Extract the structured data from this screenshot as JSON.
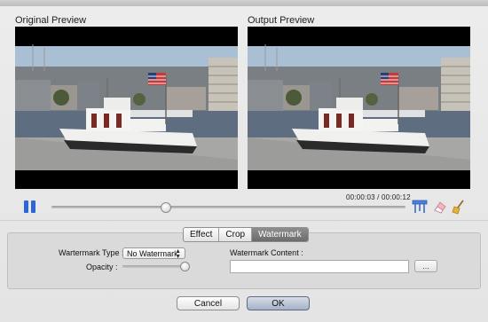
{
  "previews": {
    "original_title": "Original Preview",
    "output_title": "Output Preview"
  },
  "playback": {
    "state": "paused",
    "current_time": "00:00:03",
    "total_time": "00:00:12",
    "time_label": "00:00:03 / 00:00:12",
    "progress_fraction": 0.32
  },
  "tools": {
    "icons": [
      "crop-tool-icon",
      "eraser-icon",
      "broom-icon"
    ]
  },
  "tabs": [
    {
      "label": "Effect",
      "active": false
    },
    {
      "label": "Crop",
      "active": false
    },
    {
      "label": "Watermark",
      "active": true
    }
  ],
  "watermark": {
    "type_label": "Wartermark Type :",
    "type_value": "No Watermark",
    "opacity_label": "Opacity :",
    "opacity_fraction": 1.0,
    "content_label": "Watermark Content :",
    "content_value": "",
    "browse_label": "..."
  },
  "buttons": {
    "cancel": "Cancel",
    "ok": "OK"
  },
  "colors": {
    "accent": "#2c66d4",
    "active_tab": "#7a7a7a"
  }
}
